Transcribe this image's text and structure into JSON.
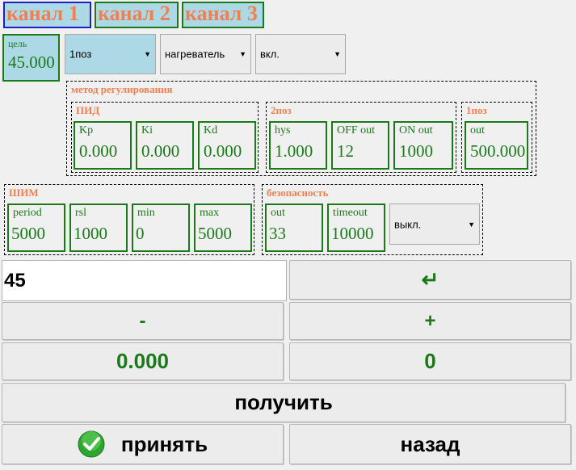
{
  "tabs": [
    "канал 1",
    "канал 2",
    "канал 3"
  ],
  "target": {
    "label": "цель",
    "value": "45.000"
  },
  "selects": {
    "mode": "1поз",
    "device": "нагреватель",
    "state": "вкл.",
    "safety_state": "выкл."
  },
  "method": {
    "title": "метод регулирования",
    "pid": {
      "title": "ПИД",
      "kp_label": "Kp",
      "kp": "0.000",
      "ki_label": "Ki",
      "ki": "0.000",
      "kd_label": "Kd",
      "kd": "0.000"
    },
    "two_pos": {
      "title": "2поз",
      "hys_label": "hys",
      "hys": "1.000",
      "off_label": "OFF out",
      "off": "12",
      "on_label": "ON out",
      "on": "1000"
    },
    "one_pos": {
      "title": "1поз",
      "out_label": "out",
      "out": "500.000"
    }
  },
  "pwm": {
    "title": "ШИМ",
    "period_label": "period",
    "period": "5000",
    "rsl_label": "rsl",
    "rsl": "1000",
    "min_label": "min",
    "min": "0",
    "max_label": "max",
    "max": "5000"
  },
  "safety": {
    "title": "безопасность",
    "out_label": "out",
    "out": "33",
    "timeout_label": "timeout",
    "timeout": "10000"
  },
  "keypad": {
    "input_value": "45",
    "enter": "↵",
    "minus": "-",
    "plus": "+",
    "left_value": "0.000",
    "right_value": "0",
    "get": "получить",
    "accept": "принять",
    "back": "назад"
  },
  "colors": {
    "accent": "#1a7a1a",
    "label": "#f08050",
    "highlight": "#add8e6"
  }
}
